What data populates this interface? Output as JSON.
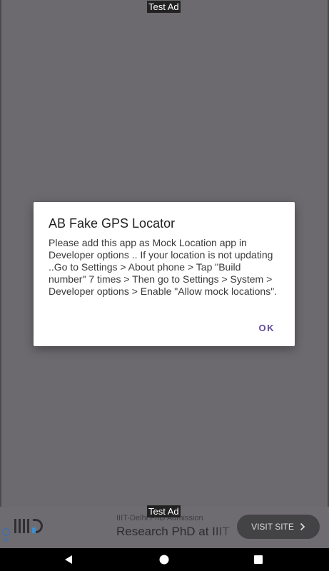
{
  "ads": {
    "top_label": "Test Ad",
    "bottom_label": "Test Ad",
    "banner": {
      "subtitle": "IIIT-Delhi PhD Admission",
      "title": "Research PhD at IIIT",
      "button_label": "VISIT SITE",
      "info_icon": "info-icon",
      "close_icon": "close-icon"
    }
  },
  "dialog": {
    "title": "AB Fake GPS Locator",
    "message": "Please add this app as Mock Location app in Developer options .. If your location is not updating ..Go to Settings > About phone > Tap \"Build number\" 7 times > Then go to Settings > System > Developer options > Enable \"Allow mock locations\".",
    "ok_label": "OK"
  },
  "nav": {
    "back_icon": "back-icon",
    "home_icon": "home-icon",
    "recents_icon": "recents-icon"
  },
  "colors": {
    "scrim": "#6c6a6e",
    "dialog_bg": "#ffffff",
    "accent": "#5e4aa0",
    "nav_bg": "#000000"
  }
}
